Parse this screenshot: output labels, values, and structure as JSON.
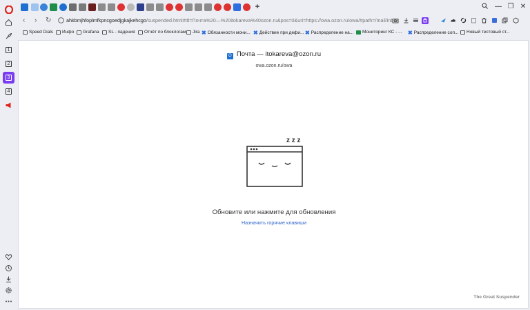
{
  "tabstrip": {
    "new_tab_label": "+",
    "search_icon": "search-icon",
    "minimize": "—",
    "restore": "❐",
    "close": "✕"
  },
  "addressbar": {
    "back": "‹",
    "forward": "›",
    "reload": "↻",
    "url_host": "ahkbmjhfoplmfkpncgoedjgkajkehcgo",
    "url_rest": "/suspended.html#ttl=Почта%20—%20itokareva%40ozon.ru&pos=0&uri=https://owa.ozon.ru/owa/#path=/mail/inbox"
  },
  "bookmarks": [
    {
      "label": "Speed Dials",
      "icon": "folder-icon"
    },
    {
      "label": "Инфо",
      "icon": "folder-icon"
    },
    {
      "label": "Grafana",
      "icon": "folder-icon"
    },
    {
      "label": "SL - падения",
      "icon": "folder-icon"
    },
    {
      "label": "Отчёт по блоклогам",
      "icon": "folder-icon"
    },
    {
      "label": "Jira",
      "icon": "folder-icon"
    },
    {
      "label": "Обязанности мони...",
      "icon": "x-icon"
    },
    {
      "label": "Действие при дефи...",
      "icon": "x-icon"
    },
    {
      "label": "Распределение на...",
      "icon": "x-icon"
    },
    {
      "label": "Мониторинг КС - ...",
      "icon": "sheet-icon"
    },
    {
      "label": "Распределение соп...",
      "icon": "x-icon"
    },
    {
      "label": "Новый тестовый ст...",
      "icon": "folder-icon"
    }
  ],
  "sidebar": {
    "items": [
      "1",
      "2",
      "3",
      "4"
    ],
    "active_index": 2
  },
  "page": {
    "title": "Почта — itokareva@ozon.ru",
    "subtitle": "owa.ozon.ru/owa",
    "sleep_letters": "z z z",
    "message": "Обновите или нажмите для обновления",
    "hotkeys_link": "Назначить горячие клавиши",
    "brand": "The Great Suspender"
  },
  "colors": {
    "accent": "#7a3cf0",
    "link": "#2e64c8"
  }
}
